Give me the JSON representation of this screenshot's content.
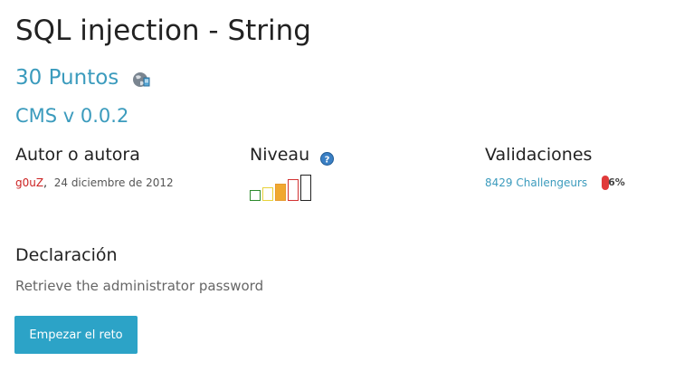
{
  "challenge": {
    "title": "SQL injection - String",
    "points": "30 Puntos",
    "version": "CMS v 0.0.2"
  },
  "author": {
    "heading": "Autor o autora",
    "name": "g0uZ",
    "separator": ",",
    "date": "24 diciembre de 2012"
  },
  "level": {
    "heading": "Niveau",
    "icon": "help-icon",
    "value": 3,
    "max": 5,
    "colors": [
      "#2d8a2d",
      "#e8d23a",
      "#e79a2d",
      "#d33333",
      "#222222"
    ]
  },
  "validations": {
    "heading": "Validaciones",
    "challengers": "8429 Challengeurs",
    "percent_text": "6%",
    "percent_value": 6,
    "bar_color": "#e03a3a"
  },
  "statement": {
    "heading": "Declaración",
    "text": "Retrieve the administrator password"
  },
  "actions": {
    "start_label": "Empezar el reto"
  },
  "colors": {
    "link": "#3b9bbd",
    "button": "#2ca3c7",
    "author_name": "#cc2222"
  }
}
